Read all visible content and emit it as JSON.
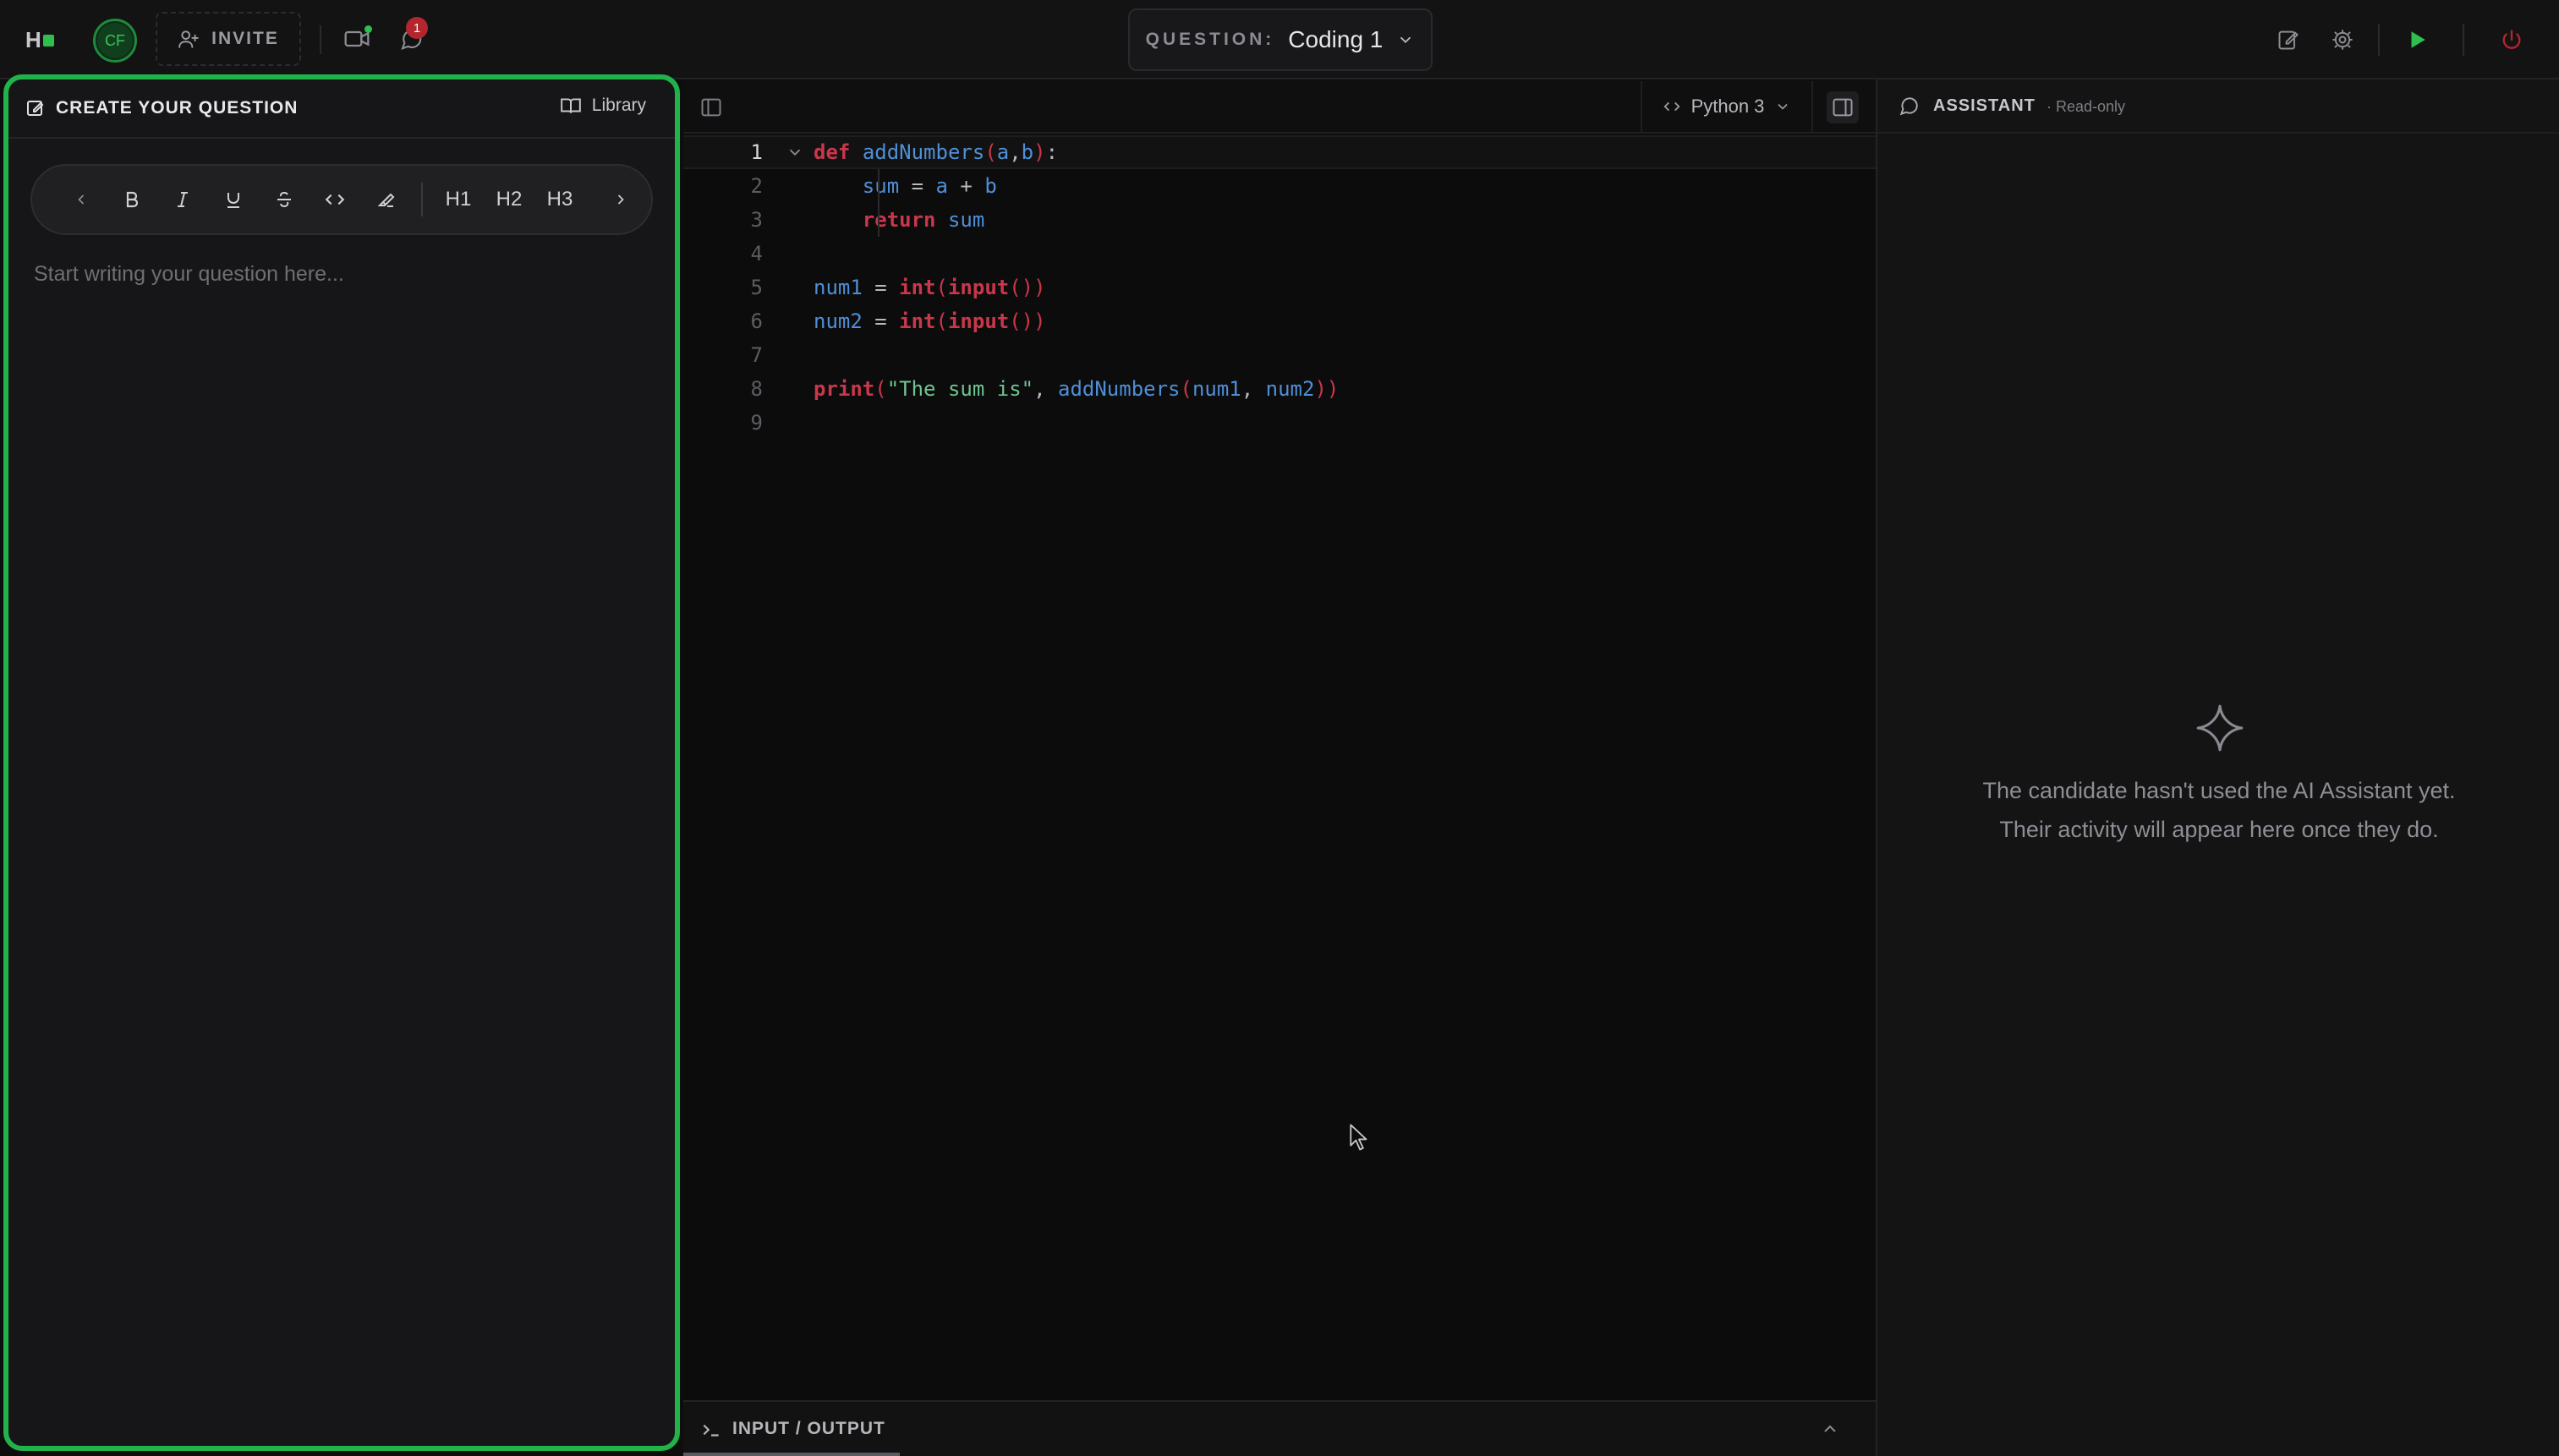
{
  "topbar": {
    "logo_text": "H",
    "avatar_initials": "CF",
    "invite_label": "INVITE",
    "notification_count": "1",
    "question_prefix": "QUESTION:",
    "question_value": "Coding 1"
  },
  "question_panel": {
    "title": "CREATE YOUR QUESTION",
    "library_label": "Library",
    "toolbar": {
      "heading1": "H1",
      "heading2": "H2",
      "heading3": "H3"
    },
    "placeholder": "Start writing your question here..."
  },
  "editor": {
    "language": "Python 3",
    "line_numbers": [
      "1",
      "2",
      "3",
      "4",
      "5",
      "6",
      "7",
      "8",
      "9"
    ],
    "lines": [
      "def addNumbers(a,b):",
      "    sum = a + b",
      "    return sum",
      "",
      "num1 = int(input())",
      "num2 = int(input())",
      "",
      "print(\"The sum is\", addNumbers(num1, num2))",
      ""
    ]
  },
  "io_panel": {
    "label": "INPUT / OUTPUT"
  },
  "assistant": {
    "title": "ASSISTANT",
    "subtitle": "· Read-only",
    "empty_line1": "The candidate hasn't used the AI Assistant yet.",
    "empty_line2": "Their activity will appear here once they do."
  },
  "colors": {
    "accent_green": "#21b24a",
    "run_green": "#2fbf4f",
    "power_red": "#b3262e",
    "keyword_red": "#c9374a",
    "identifier_blue": "#4f8fd6",
    "string_green": "#6fc58f"
  },
  "icons": [
    "logo-mark",
    "user-plus-icon",
    "video-icon",
    "chat-icon",
    "chevron-down-icon",
    "edit-note-icon",
    "gear-icon",
    "play-icon",
    "power-icon",
    "pencil-square-icon",
    "book-icon",
    "chevron-left-icon",
    "bold-icon",
    "italic-icon",
    "underline-icon",
    "strikethrough-icon",
    "code-icon",
    "highlighter-icon",
    "chevron-right-icon",
    "sidebar-toggle-icon",
    "terminal-icon",
    "chevron-up-icon",
    "message-icon",
    "sparkle-icon",
    "mouse-cursor-icon"
  ]
}
